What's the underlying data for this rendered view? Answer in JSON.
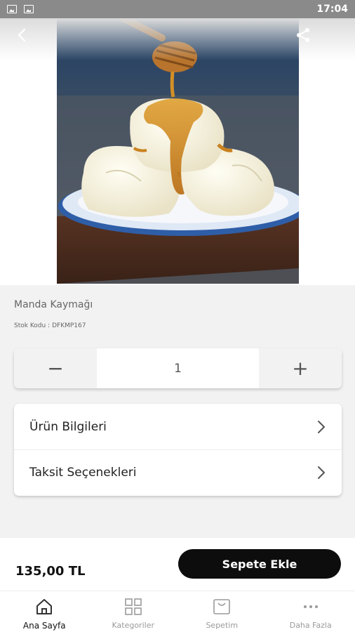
{
  "status_bar": {
    "time": "17:04",
    "icons": [
      "image-icon",
      "text-icon"
    ]
  },
  "nav": {
    "back_icon": "chevron-left-icon",
    "share_icon": "share-icon"
  },
  "product": {
    "name": "Manda Kaymağı",
    "stock_code_label": "Stok Kodu :",
    "stock_code": "DFKMP167",
    "quantity": "1",
    "minus_label": "−",
    "plus_label": "+"
  },
  "menu": [
    {
      "label": "Ürün Bilgileri",
      "icon": "chevron-right-icon"
    },
    {
      "label": "Taksit Seçenekleri",
      "icon": "chevron-right-icon"
    }
  ],
  "purchase": {
    "price": "135,00 TL",
    "add_to_cart": "Sepete Ekle"
  },
  "tabbar": [
    {
      "label": "Ana Sayfa",
      "icon": "home-icon",
      "active": true
    },
    {
      "label": "Kategoriler",
      "icon": "grid-icon",
      "active": false
    },
    {
      "label": "Sepetim",
      "icon": "basket-icon",
      "active": false
    },
    {
      "label": "Daha Fazla",
      "icon": "more-icon",
      "active": false
    }
  ]
}
